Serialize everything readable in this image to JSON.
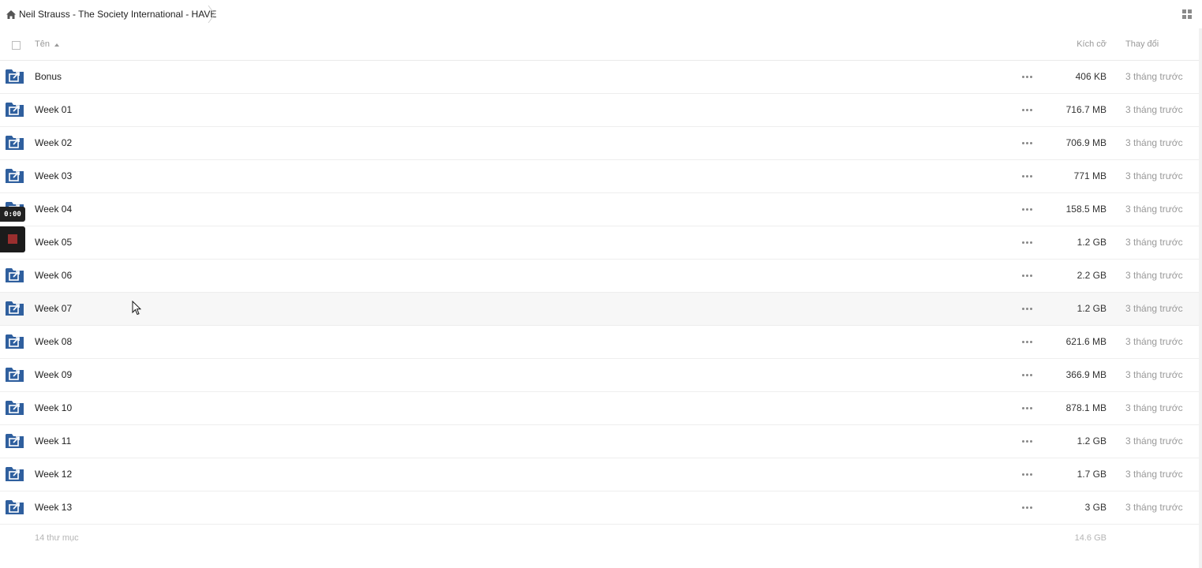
{
  "breadcrumb": {
    "folder": "Neil Strauss - The Society International - HAVE"
  },
  "header": {
    "name": "Tên",
    "size": "Kích cỡ",
    "modified": "Thay đổi"
  },
  "rows": [
    {
      "name": "Bonus",
      "size": "406 KB",
      "modified": "3 tháng trước"
    },
    {
      "name": "Week 01",
      "size": "716.7 MB",
      "modified": "3 tháng trước"
    },
    {
      "name": "Week 02",
      "size": "706.9 MB",
      "modified": "3 tháng trước"
    },
    {
      "name": "Week 03",
      "size": "771 MB",
      "modified": "3 tháng trước"
    },
    {
      "name": "Week 04",
      "size": "158.5 MB",
      "modified": "3 tháng trước"
    },
    {
      "name": "Week 05",
      "size": "1.2 GB",
      "modified": "3 tháng trước"
    },
    {
      "name": "Week 06",
      "size": "2.2 GB",
      "modified": "3 tháng trước"
    },
    {
      "name": "Week 07",
      "size": "1.2 GB",
      "modified": "3 tháng trước"
    },
    {
      "name": "Week 08",
      "size": "621.6 MB",
      "modified": "3 tháng trước"
    },
    {
      "name": "Week 09",
      "size": "366.9 MB",
      "modified": "3 tháng trước"
    },
    {
      "name": "Week 10",
      "size": "878.1 MB",
      "modified": "3 tháng trước"
    },
    {
      "name": "Week 11",
      "size": "1.2 GB",
      "modified": "3 tháng trước"
    },
    {
      "name": "Week 12",
      "size": "1.7 GB",
      "modified": "3 tháng trước"
    },
    {
      "name": "Week 13",
      "size": "3 GB",
      "modified": "3 tháng trước"
    }
  ],
  "footer": {
    "count": "14 thư mục",
    "total_size": "14.6 GB"
  },
  "recorder": {
    "timer": "0:00"
  },
  "icons": {
    "home": "home-icon",
    "folder": "shared-folder-icon",
    "more": "more-actions-icon",
    "grid": "grid-view-icon",
    "stop": "stop-recording-icon",
    "sort": "sort-ascending-icon"
  },
  "colors": {
    "folder": "#2f5f9e",
    "stop": "#9a2e2e",
    "hover_row": "#f7f7f7"
  }
}
